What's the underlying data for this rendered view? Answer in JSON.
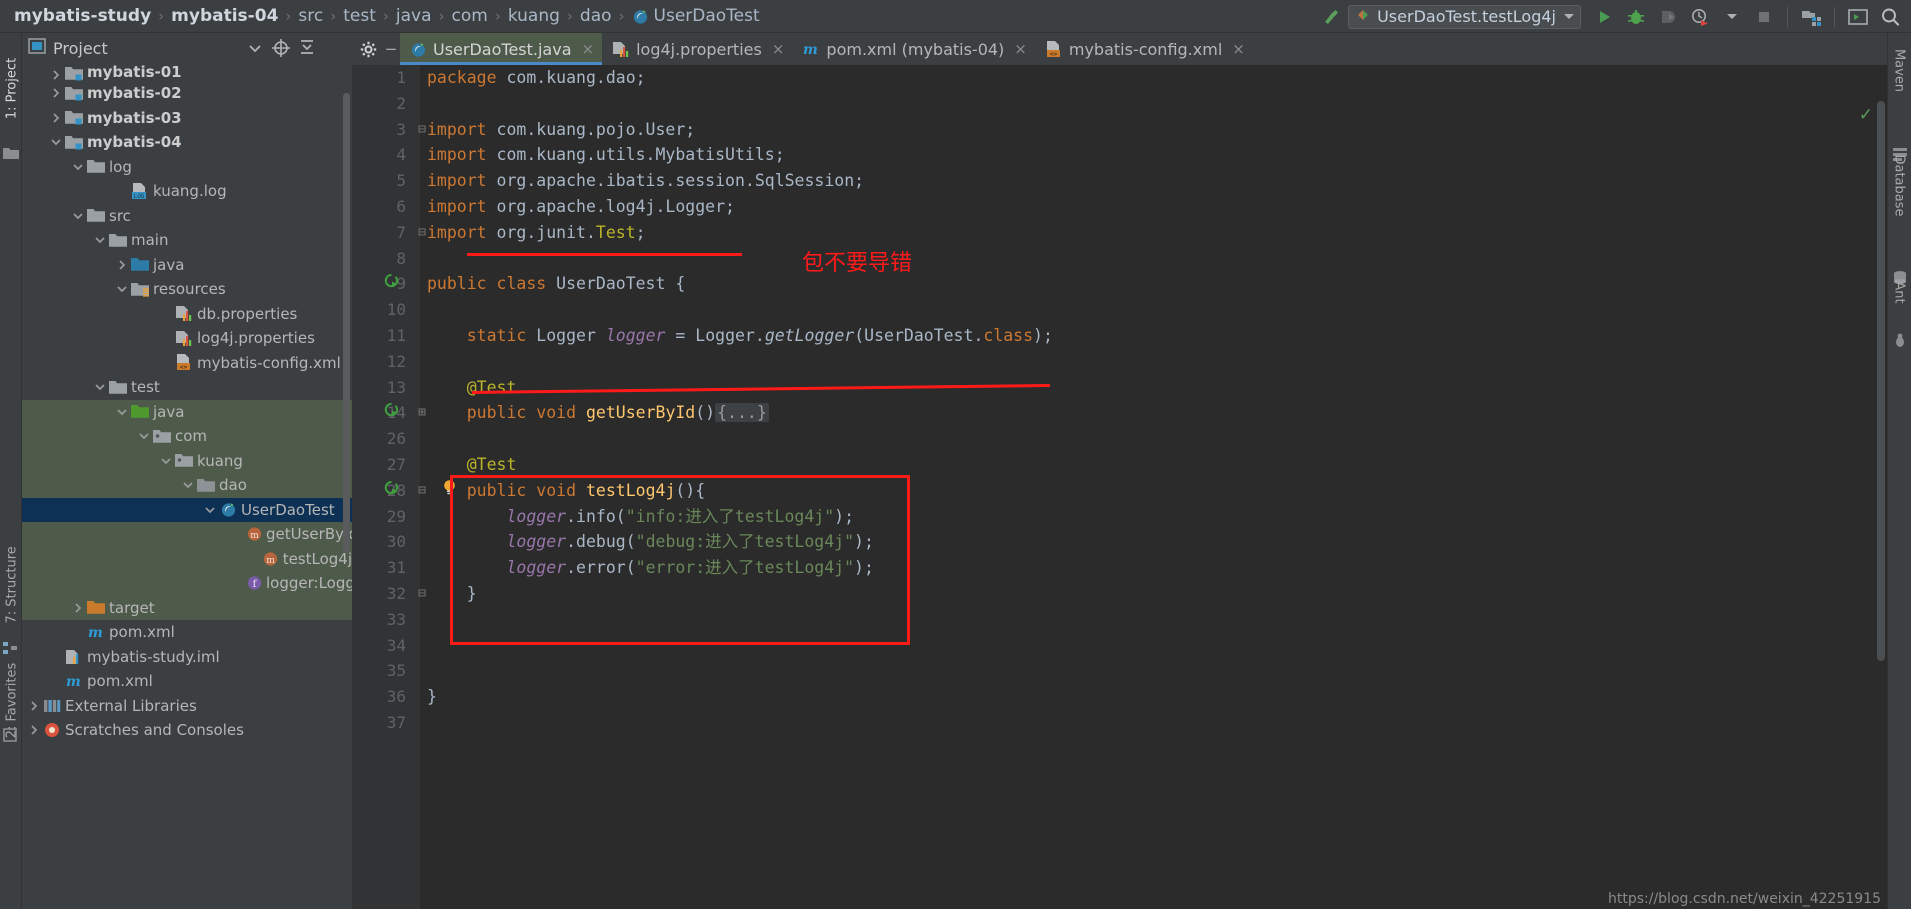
{
  "breadcrumb": {
    "items": [
      {
        "label": "mybatis-study",
        "bold": true
      },
      {
        "label": "mybatis-04",
        "bold": true
      },
      {
        "label": "src",
        "bold": false
      },
      {
        "label": "test",
        "bold": false
      },
      {
        "label": "java",
        "bold": false
      },
      {
        "label": "com",
        "bold": false
      },
      {
        "label": "kuang",
        "bold": false
      },
      {
        "label": "dao",
        "bold": false
      },
      {
        "label": "UserDaoTest",
        "bold": false,
        "icon": "java-class-icon"
      }
    ],
    "separator": "›"
  },
  "toolbar": {
    "build_icon": "hammer-icon",
    "run_config": {
      "label": "UserDaoTest.testLog4j",
      "icon": "run-config-icon",
      "dropdown": "▾"
    },
    "buttons": [
      {
        "name": "run-button",
        "icon": "play-icon"
      },
      {
        "name": "debug-button",
        "icon": "bug-icon"
      },
      {
        "name": "run-with-coverage-button",
        "icon": "coverage-icon"
      },
      {
        "name": "profile-button",
        "icon": "clock-run-icon"
      },
      {
        "name": "profile-dropdown",
        "icon": "chevron-down-icon"
      },
      {
        "name": "stop-button",
        "icon": "stop-icon"
      },
      {
        "name": "project-structure-button",
        "icon": "project-structure-icon"
      },
      {
        "name": "terminal-button",
        "icon": "terminal-icon"
      },
      {
        "name": "search-everywhere-button",
        "icon": "search-icon"
      }
    ]
  },
  "left_strips": [
    {
      "label": "1: Project",
      "active": true
    },
    {
      "label": "7: Structure",
      "active": false
    },
    {
      "label": "2: Favorites",
      "active": false
    }
  ],
  "right_strips": [
    {
      "label": "Maven"
    },
    {
      "label": "Database"
    },
    {
      "label": "Ant"
    }
  ],
  "project_panel": {
    "title": "Project",
    "header_buttons": [
      {
        "name": "project-view-dropdown",
        "icon": "chevron-down-icon"
      },
      {
        "name": "scroll-from-source-button",
        "icon": "target-icon"
      },
      {
        "name": "collapse-all-button",
        "icon": "collapse-all-icon"
      }
    ],
    "tree": [
      {
        "label": "mybatis-01",
        "indent": 1,
        "twisty": "›",
        "icon": "module-folder-icon",
        "bold": true,
        "bg": "none",
        "clipped": true
      },
      {
        "label": "mybatis-02",
        "indent": 1,
        "twisty": "›",
        "icon": "module-folder-icon",
        "bold": true,
        "bg": "none"
      },
      {
        "label": "mybatis-03",
        "indent": 1,
        "twisty": "›",
        "icon": "module-folder-icon",
        "bold": true,
        "bg": "none"
      },
      {
        "label": "mybatis-04",
        "indent": 1,
        "twisty": "⌄",
        "icon": "module-folder-icon",
        "bold": true,
        "bg": "none"
      },
      {
        "label": "log",
        "indent": 2,
        "twisty": "⌄",
        "icon": "folder-icon",
        "bold": false,
        "bg": "none"
      },
      {
        "label": "kuang.log",
        "indent": 4,
        "twisty": "",
        "icon": "log-file-icon",
        "bold": false,
        "bg": "none"
      },
      {
        "label": "src",
        "indent": 2,
        "twisty": "⌄",
        "icon": "folder-icon",
        "bold": false,
        "bg": "none"
      },
      {
        "label": "main",
        "indent": 3,
        "twisty": "⌄",
        "icon": "folder-icon",
        "bold": false,
        "bg": "none"
      },
      {
        "label": "java",
        "indent": 4,
        "twisty": "›",
        "icon": "source-root-folder-icon",
        "bold": false,
        "bg": "none"
      },
      {
        "label": "resources",
        "indent": 4,
        "twisty": "⌄",
        "icon": "resources-folder-icon",
        "bold": false,
        "bg": "none"
      },
      {
        "label": "db.properties",
        "indent": 6,
        "twisty": "",
        "icon": "properties-file-icon",
        "bold": false,
        "bg": "none"
      },
      {
        "label": "log4j.properties",
        "indent": 6,
        "twisty": "",
        "icon": "properties-file-icon",
        "bold": false,
        "bg": "none"
      },
      {
        "label": "mybatis-config.xml",
        "indent": 6,
        "twisty": "",
        "icon": "xml-file-icon",
        "bold": false,
        "bg": "none"
      },
      {
        "label": "test",
        "indent": 3,
        "twisty": "⌄",
        "icon": "folder-icon",
        "bold": false,
        "bg": "none"
      },
      {
        "label": "java",
        "indent": 4,
        "twisty": "⌄",
        "icon": "test-source-root-icon",
        "bold": false,
        "bg": "green"
      },
      {
        "label": "com",
        "indent": 5,
        "twisty": "⌄",
        "icon": "package-icon",
        "bold": false,
        "bg": "green"
      },
      {
        "label": "kuang",
        "indent": 6,
        "twisty": "⌄",
        "icon": "package-icon",
        "bold": false,
        "bg": "green"
      },
      {
        "label": "dao",
        "indent": 7,
        "twisty": "⌄",
        "icon": "test-package-icon",
        "bold": false,
        "bg": "green"
      },
      {
        "label": "UserDaoTest",
        "indent": 8,
        "twisty": "⌄",
        "icon": "java-class-icon",
        "bold": false,
        "bg": "selected"
      },
      {
        "label": "getUserById",
        "indent": 10,
        "twisty": "",
        "icon": "method-icon",
        "bold": false,
        "bg": "green"
      },
      {
        "label": "testLog4j",
        "indent": 10,
        "twisty": "",
        "icon": "method-icon",
        "bold": false,
        "bg": "green"
      },
      {
        "label": "logger:Logger",
        "indent": 10,
        "twisty": "",
        "icon": "field-icon",
        "bold": false,
        "bg": "green"
      },
      {
        "label": "target",
        "indent": 2,
        "twisty": "›",
        "icon": "excluded-folder-icon",
        "bold": false,
        "bg": "green"
      },
      {
        "label": "pom.xml",
        "indent": 2,
        "twisty": "",
        "icon": "maven-file-icon",
        "bold": false,
        "bg": "none"
      },
      {
        "label": "mybatis-study.iml",
        "indent": 1,
        "twisty": "",
        "icon": "iml-file-icon",
        "bold": false,
        "bg": "none"
      },
      {
        "label": "pom.xml",
        "indent": 1,
        "twisty": "",
        "icon": "maven-file-icon",
        "bold": false,
        "bg": "none"
      },
      {
        "label": "External Libraries",
        "indent": 0,
        "twisty": "›",
        "icon": "library-icon",
        "bold": false,
        "bg": "none"
      },
      {
        "label": "Scratches and Consoles",
        "indent": 0,
        "twisty": "›",
        "icon": "scratches-icon",
        "bold": false,
        "bg": "none"
      }
    ]
  },
  "editor": {
    "tabs": [
      {
        "label": "UserDaoTest.java",
        "icon": "java-class-icon",
        "active": true,
        "close": "×"
      },
      {
        "label": "log4j.properties",
        "icon": "properties-file-icon",
        "active": false,
        "close": "×"
      },
      {
        "label": "pom.xml (mybatis-04)",
        "icon": "maven-file-icon",
        "active": false,
        "close": "×"
      },
      {
        "label": "mybatis-config.xml",
        "icon": "xml-file-icon",
        "active": false,
        "close": "×"
      }
    ],
    "inspection_ok": "✓",
    "lines": [
      {
        "num": "1",
        "gutter": "",
        "fold": "",
        "html": "<span class='kw'>package</span> <span class='cls'>com.kuang.dao</span><span class='pun'>;</span>"
      },
      {
        "num": "2",
        "gutter": "",
        "fold": "",
        "html": ""
      },
      {
        "num": "3",
        "gutter": "",
        "fold": "⊟",
        "html": "<span class='kw'>import</span> <span class='cls'>com.kuang.pojo.User</span><span class='pun'>;</span>"
      },
      {
        "num": "4",
        "gutter": "",
        "fold": "",
        "html": "<span class='kw'>import</span> <span class='cls'>com.kuang.utils.MybatisUtils</span><span class='pun'>;</span>"
      },
      {
        "num": "5",
        "gutter": "",
        "fold": "",
        "html": "<span class='kw'>import</span> <span class='cls'>org.apache.ibatis.session.SqlSession</span><span class='pun'>;</span>"
      },
      {
        "num": "6",
        "gutter": "",
        "fold": "",
        "html": "<span class='kw'>import</span> <span class='cls'>org.apache.log4j.Logger</span><span class='pun'>;</span>"
      },
      {
        "num": "7",
        "gutter": "",
        "fold": "⊟",
        "html": "<span class='kw'>import</span> <span class='cls'>org.junit.</span><span class='ann'>Test</span><span class='pun'>;</span>"
      },
      {
        "num": "8",
        "gutter": "",
        "fold": "",
        "html": ""
      },
      {
        "num": "9",
        "gutter": "run-test-icon",
        "fold": "",
        "html": "<span class='kw'>public class</span> <span class='cls'>UserDaoTest</span> <span class='pun'>{</span>"
      },
      {
        "num": "10",
        "gutter": "",
        "fold": "",
        "html": ""
      },
      {
        "num": "11",
        "gutter": "",
        "fold": "",
        "html": "    <span class='kw'>static</span> <span class='cls'>Logger</span> <span class='fld'>logger</span> <span class='pun'>=</span> <span class='cls'>Logger</span><span class='pun'>.</span><span class='stat'>getLogger</span><span class='paren'>(</span><span class='cls'>UserDaoTest</span><span class='pun'>.</span><span class='kw'>class</span><span class='paren'>)</span><span class='pun'>;</span>"
      },
      {
        "num": "12",
        "gutter": "",
        "fold": "",
        "html": ""
      },
      {
        "num": "13",
        "gutter": "",
        "fold": "",
        "html": "    <span class='ann'>@Test</span>"
      },
      {
        "num": "14",
        "gutter": "run-test-icon",
        "fold": "⊞",
        "html": "    <span class='kw'>public void</span> <span class='mth'>getUserById</span><span class='paren'>()</span><span class='foldbox'>{...}</span>"
      },
      {
        "num": "26",
        "gutter": "",
        "fold": "",
        "html": ""
      },
      {
        "num": "27",
        "gutter": "",
        "fold": "",
        "html": "    <span class='ann'>@Test</span>"
      },
      {
        "num": "28",
        "gutter": "run-test-icon",
        "fold": "⊟",
        "html": "    <span class='kw'>public void</span> <span class='mth'>testLog4j</span><span class='paren'>(){</span>",
        "bulb": true
      },
      {
        "num": "29",
        "gutter": "",
        "fold": "",
        "html": "        <span class='fld'>logger</span><span class='pun'>.</span><span class='cls'>info</span><span class='paren'>(</span><span class='str'>\"info:进入了testLog4j\"</span><span class='paren'>)</span><span class='pun'>;</span>"
      },
      {
        "num": "30",
        "gutter": "",
        "fold": "",
        "html": "        <span class='fld'>logger</span><span class='pun'>.</span><span class='cls'>debug</span><span class='paren'>(</span><span class='str'>\"debug:进入了testLog4j\"</span><span class='paren'>)</span><span class='pun'>;</span>"
      },
      {
        "num": "31",
        "gutter": "",
        "fold": "",
        "html": "        <span class='fld'>logger</span><span class='pun'>.</span><span class='cls'>error</span><span class='paren'>(</span><span class='str'>\"error:进入了testLog4j\"</span><span class='paren'>)</span><span class='pun'>;</span>"
      },
      {
        "num": "32",
        "gutter": "",
        "fold": "⊟",
        "html": "    <span class='pun'>}</span>"
      },
      {
        "num": "33",
        "gutter": "",
        "fold": "",
        "html": ""
      },
      {
        "num": "34",
        "gutter": "",
        "fold": "",
        "html": ""
      },
      {
        "num": "35",
        "gutter": "",
        "fold": "",
        "html": ""
      },
      {
        "num": "36",
        "gutter": "",
        "fold": "",
        "html": "<span class='pun'>}</span>"
      },
      {
        "num": "37",
        "gutter": "",
        "fold": "",
        "html": ""
      }
    ]
  },
  "annotations": {
    "note_text": "包不要导错",
    "color": "#ff1a1a"
  },
  "status_bar": {
    "url": "https://blog.csdn.net/weixin_42251915"
  },
  "colors": {
    "window_bg": "#3c3f41",
    "editor_bg": "#2b2b2b",
    "gutter_bg": "#313335",
    "selection_blue": "#0d3055",
    "test_scope_green": "#4e5b4b",
    "accent_red": "#ff1a1a",
    "tab_underline": "#4a88c7"
  }
}
